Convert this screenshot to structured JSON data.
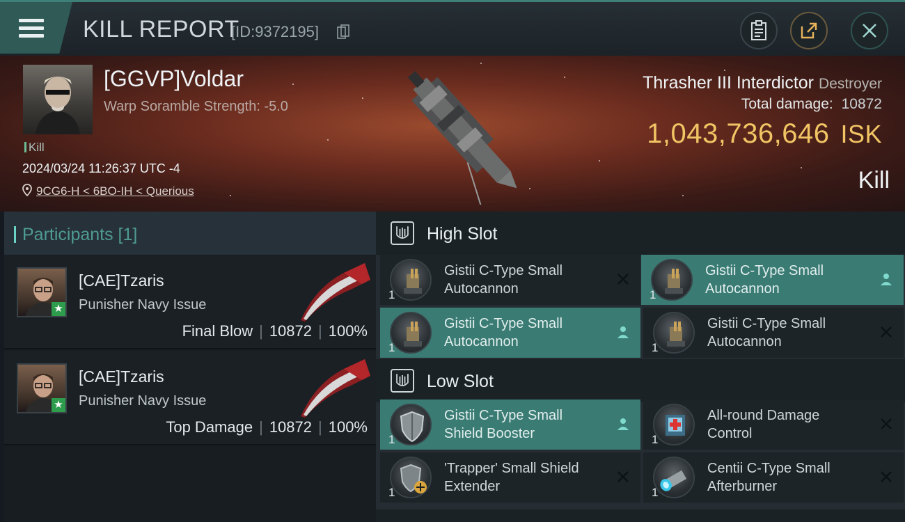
{
  "window": {
    "title": "KILL REPORT",
    "report_id": "[ID:9372195]"
  },
  "victim": {
    "name": "[GGVP]Voldar",
    "subtitle": "Warp Soramble Strength: -5.0",
    "tag": "Kill",
    "datetime": "2024/03/24 11:26:37 UTC -4",
    "location": "9CG6-H < 6BO-IH < Querious"
  },
  "ship": {
    "name": "Thrasher III Interdictor",
    "class": "Destroyer",
    "total_damage_label": "Total damage:",
    "total_damage": "10872",
    "isk_value": "1,043,736,646",
    "isk_unit": "ISK",
    "outcome": "Kill"
  },
  "participants": {
    "header": "Participants [1]",
    "items": [
      {
        "name": "[CAE]Tzaris",
        "ship": "Punisher Navy Issue",
        "role": "Final Blow",
        "damage": "10872",
        "percent": "100%"
      },
      {
        "name": "[CAE]Tzaris",
        "ship": "Punisher Navy Issue",
        "role": "Top Damage",
        "damage": "10872",
        "percent": "100%"
      }
    ]
  },
  "slots": {
    "high": {
      "title": "High Slot",
      "modules": [
        {
          "name": "Gistii C-Type Small Autocannon",
          "qty": "1",
          "state": "destroyed",
          "icon": "autocannon-icon"
        },
        {
          "name": "Gistii C-Type Small Autocannon",
          "qty": "1",
          "state": "dropped",
          "icon": "autocannon-icon"
        },
        {
          "name": "Gistii C-Type Small Autocannon",
          "qty": "1",
          "state": "dropped",
          "icon": "autocannon-icon"
        },
        {
          "name": "Gistii C-Type Small Autocannon",
          "qty": "1",
          "state": "destroyed",
          "icon": "autocannon-icon"
        }
      ]
    },
    "low": {
      "title": "Low Slot",
      "modules": [
        {
          "name": "Gistii C-Type Small Shield Booster",
          "qty": "1",
          "state": "dropped",
          "icon": "shield-booster-icon"
        },
        {
          "name": "All-round Damage Control",
          "qty": "1",
          "state": "destroyed",
          "icon": "damage-control-icon"
        },
        {
          "name": "'Trapper' Small Shield Extender",
          "qty": "1",
          "state": "destroyed",
          "icon": "shield-extender-icon"
        },
        {
          "name": "Centii C-Type Small Afterburner",
          "qty": "1",
          "state": "destroyed",
          "icon": "afterburner-icon"
        }
      ]
    }
  },
  "colors": {
    "accent": "#3a7b74",
    "isk_gold": "#f1c464",
    "header_teal": "#4f9b93"
  }
}
